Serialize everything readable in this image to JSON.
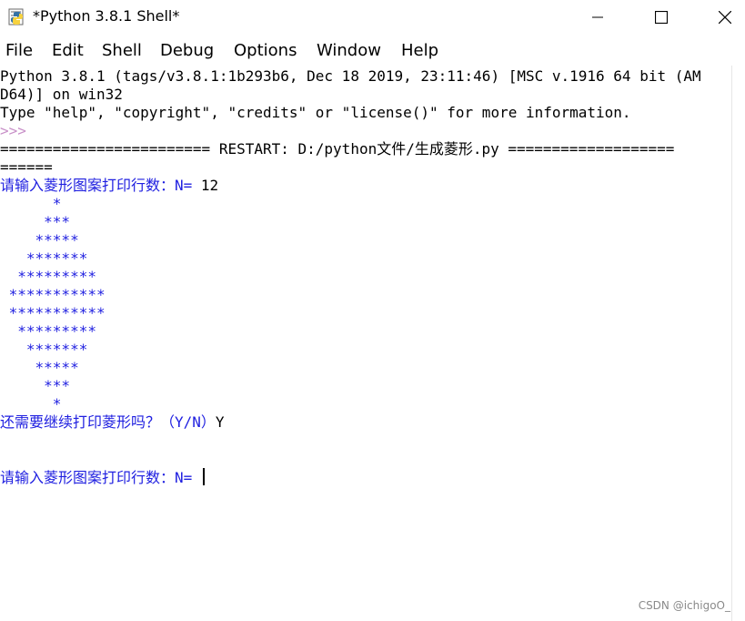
{
  "window": {
    "title": "*Python 3.8.1 Shell*"
  },
  "menu": [
    "File",
    "Edit",
    "Shell",
    "Debug",
    "Options",
    "Window",
    "Help"
  ],
  "console": {
    "banner_line1": "Python 3.8.1 (tags/v3.8.1:1b293b6, Dec 18 2019, 23:11:46) [MSC v.1916 64 bit (AM",
    "banner_line2": "D64)] on win32",
    "banner_line3": "Type \"help\", \"copyright\", \"credits\" or \"license()\" for more information.",
    "prompt": ">>> ",
    "restart_line1": "======================== RESTART: D:/python文件/生成菱形.py ===================",
    "restart_line2": "======",
    "input_prompt_1": "请输入菱形图案打印行数：N= ",
    "input_value_1": "12",
    "diamond": [
      "      *",
      "     ***",
      "    *****",
      "   *******",
      "  *********",
      " ***********",
      " ***********",
      "  *********",
      "   *******",
      "    *****",
      "     ***",
      "      *"
    ],
    "continue_prompt": "还需要继续打印菱形吗？（Y/N）",
    "continue_value": "Y",
    "input_prompt_2": "请输入菱形图案打印行数：N= "
  },
  "watermark": "CSDN @ichigoO_"
}
